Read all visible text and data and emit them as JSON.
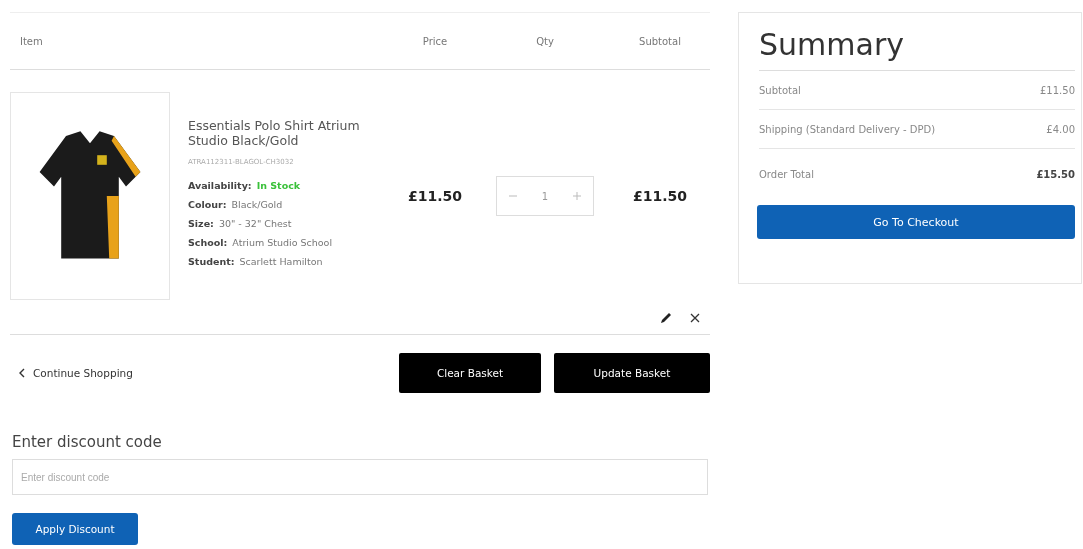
{
  "cart": {
    "columns": [
      "Item",
      "Price",
      "Qty",
      "Subtotal"
    ],
    "items": [
      {
        "name": "Essentials Polo Shirt Atrium Studio Black/Gold",
        "sku": "ATRA112311-BLAGOL-CH3032",
        "availability_label": "Availability:",
        "availability": "In Stock",
        "in_stock": true,
        "attributes": [
          {
            "label": "Colour:",
            "value": "Black/Gold"
          },
          {
            "label": "Size:",
            "value": "30\" - 32\" Chest"
          },
          {
            "label": "School:",
            "value": "Atrium Studio School"
          },
          {
            "label": "Student:",
            "value": "Scarlett Hamilton"
          }
        ],
        "price": "£11.50",
        "qty": "1",
        "subtotal": "£11.50"
      }
    ],
    "continue_link": "Continue Shopping",
    "buttons": [
      "Clear Basket",
      "Update Basket"
    ]
  },
  "discount": {
    "heading": "Enter discount code",
    "placeholder": "Enter discount code",
    "button": "Apply Discount"
  },
  "summary": {
    "title": "Summary",
    "rows": [
      {
        "label": "Subtotal",
        "value": "£11.50",
        "kind": "normal"
      },
      {
        "label": "Shipping (Standard Delivery - DPD)",
        "value": "£4.00",
        "kind": "normal"
      },
      {
        "label": "Order Total",
        "value": "£15.50",
        "kind": "total"
      }
    ],
    "button": "Go To Checkout"
  }
}
